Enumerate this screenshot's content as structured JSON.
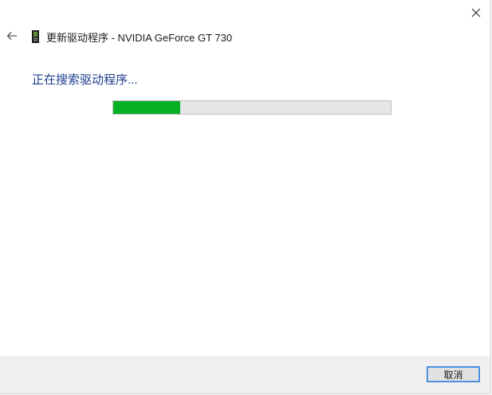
{
  "window": {
    "title": "更新驱动程序 - NVIDIA GeForce GT 730"
  },
  "icons": {
    "close": "close-icon",
    "back": "back-arrow-icon",
    "device": "gpu-device-icon"
  },
  "status": {
    "text": "正在搜索驱动程序..."
  },
  "progress": {
    "fraction": 0.24,
    "fill_color": "#06b025"
  },
  "footer": {
    "cancel_label": "取消"
  }
}
